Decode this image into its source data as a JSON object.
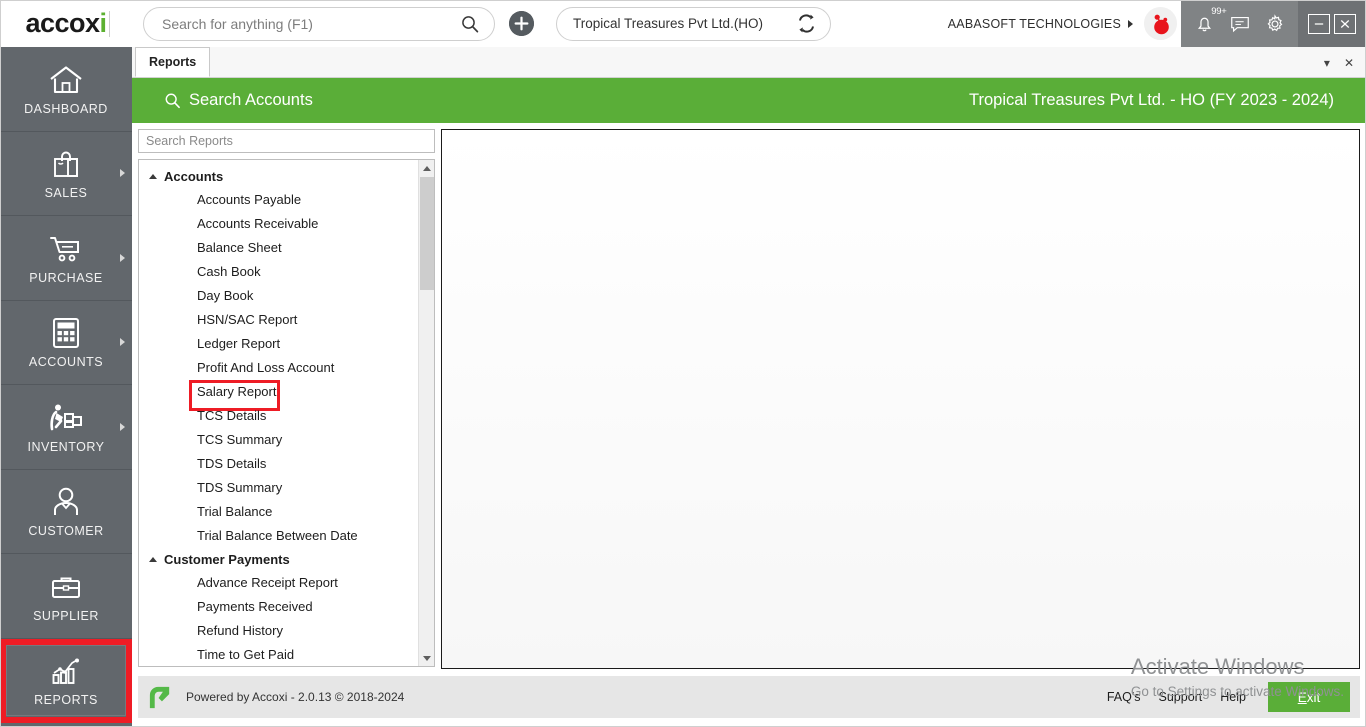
{
  "app": {
    "logo_text_a": "accox",
    "logo_text_x": "i"
  },
  "topbar": {
    "search_placeholder": "Search for anything (F1)",
    "search_value": "",
    "search_icon": "search-icon",
    "add_icon": "plus-icon",
    "branch_name": "Tropical Treasures Pvt Ltd.(HO)",
    "branch_switch_icon": "swap-icon",
    "company_name": "AABASOFT TECHNOLOGIES",
    "company_caret_icon": "caret-right-icon",
    "avatar_icon": "cherry-avatar-icon",
    "notification_icon": "bell-icon",
    "notification_badge": "99+",
    "message_icon": "message-icon",
    "settings_icon": "gear-icon",
    "minimize_icon": "minimize-icon",
    "close_icon": "close-icon"
  },
  "tabbar": {
    "tabs": [
      {
        "label": "Reports",
        "active": true
      }
    ],
    "dropdown_icon": "chevron-down-icon",
    "close_icon": "close-icon"
  },
  "green_header": {
    "search_icon": "search-icon",
    "title": "Search Accounts",
    "company_fy": "Tropical Treasures Pvt Ltd. - HO (FY 2023 - 2024)"
  },
  "left_panel": {
    "search_placeholder": "Search Reports",
    "search_value": "",
    "groups": [
      {
        "label": "Accounts",
        "expanded": true,
        "collapse_icon": "caret-up-icon",
        "items": [
          {
            "label": "Accounts Payable",
            "highlighted": false
          },
          {
            "label": "Accounts Receivable",
            "highlighted": false
          },
          {
            "label": "Balance Sheet",
            "highlighted": false
          },
          {
            "label": "Cash Book",
            "highlighted": false
          },
          {
            "label": "Day Book",
            "highlighted": false
          },
          {
            "label": "HSN/SAC Report",
            "highlighted": false
          },
          {
            "label": "Ledger Report",
            "highlighted": false
          },
          {
            "label": "Profit And Loss Account",
            "highlighted": false
          },
          {
            "label": "Salary Report",
            "highlighted": true
          },
          {
            "label": "TCS Details",
            "highlighted": false
          },
          {
            "label": "TCS Summary",
            "highlighted": false
          },
          {
            "label": "TDS Details",
            "highlighted": false
          },
          {
            "label": "TDS Summary",
            "highlighted": false
          },
          {
            "label": "Trial Balance",
            "highlighted": false
          },
          {
            "label": "Trial Balance Between Date",
            "highlighted": false
          }
        ]
      },
      {
        "label": "Customer Payments",
        "expanded": true,
        "collapse_icon": "caret-up-icon",
        "items": [
          {
            "label": "Advance Receipt Report",
            "highlighted": false
          },
          {
            "label": "Payments Received",
            "highlighted": false
          },
          {
            "label": "Refund History",
            "highlighted": false
          },
          {
            "label": "Time to Get Paid",
            "highlighted": false
          }
        ]
      }
    ],
    "scroll_up_icon": "triangle-up-icon",
    "scroll_down_icon": "triangle-down-icon"
  },
  "sidebar": {
    "items": [
      {
        "label": "DASHBOARD",
        "icon": "home-icon",
        "has_arrow": false,
        "highlighted": false
      },
      {
        "label": "SALES",
        "icon": "bag-icon",
        "has_arrow": true,
        "highlighted": false
      },
      {
        "label": "PURCHASE",
        "icon": "cart-icon",
        "has_arrow": true,
        "highlighted": false
      },
      {
        "label": "ACCOUNTS",
        "icon": "calculator-icon",
        "has_arrow": true,
        "highlighted": false
      },
      {
        "label": "INVENTORY",
        "icon": "forklift-icon",
        "has_arrow": true,
        "highlighted": false
      },
      {
        "label": "CUSTOMER",
        "icon": "person-icon",
        "has_arrow": false,
        "highlighted": false
      },
      {
        "label": "SUPPLIER",
        "icon": "briefcase-icon",
        "has_arrow": false,
        "highlighted": false
      },
      {
        "label": "REPORTS",
        "icon": "chart-icon",
        "has_arrow": false,
        "highlighted": true
      }
    ]
  },
  "watermark": {
    "title": "Activate Windows",
    "subtitle": "Go to Settings to activate Windows."
  },
  "footer": {
    "logo_icon": "accoxi-arrow-icon",
    "text": "Powered by Accoxi - 2.0.13 © 2018-2024",
    "links": [
      "FAQ's",
      "Support",
      "Help"
    ],
    "exit_label_underlined": "E",
    "exit_label_rest": "xit"
  },
  "colors": {
    "brand_green": "#5aae38",
    "sidebar_gray": "#62676c",
    "highlight_red": "#ee1c25",
    "icon_strip_gray": "#808385",
    "footer_gray": "#e6e6e6"
  }
}
